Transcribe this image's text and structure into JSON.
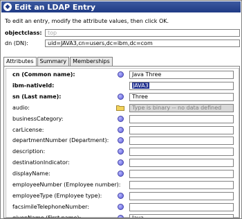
{
  "window": {
    "title": "Edit an LDAP Entry"
  },
  "instructions": "To edit an entry, modify the attribute values, then click OK.",
  "objectclass": {
    "label": "objectclass:",
    "value": "top"
  },
  "dn": {
    "label": "dn (DN):",
    "value": "uid=JAVA3,cn=users,dc=ibm,dc=com"
  },
  "tabs": [
    {
      "label": "Attributes",
      "active": true
    },
    {
      "label": "Summary",
      "active": false
    },
    {
      "label": "Memberships",
      "active": false
    }
  ],
  "attributes": [
    {
      "label": "cn (Common name):",
      "bold": true,
      "icon": "required-icon",
      "value": "Java Three",
      "style": "normal"
    },
    {
      "label": "ibm-nativeId:",
      "bold": true,
      "icon": "none",
      "value": "JAVA3",
      "style": "selected"
    },
    {
      "label": "sn (Last name):",
      "bold": true,
      "icon": "required-icon",
      "value": "Three",
      "style": "normal"
    },
    {
      "label": "audio:",
      "bold": false,
      "icon": "folder-icon",
      "value": "Type is binary -- no data defined",
      "style": "grey"
    },
    {
      "label": "businessCategory:",
      "bold": false,
      "icon": "required-icon",
      "value": "",
      "style": "normal"
    },
    {
      "label": "carLicense:",
      "bold": false,
      "icon": "required-icon",
      "value": "",
      "style": "normal"
    },
    {
      "label": "departmentNumber (Department):",
      "bold": false,
      "icon": "required-icon",
      "value": "",
      "style": "normal"
    },
    {
      "label": "description:",
      "bold": false,
      "icon": "required-icon",
      "value": "",
      "style": "normal"
    },
    {
      "label": "destinationIndicator:",
      "bold": false,
      "icon": "required-icon",
      "value": "",
      "style": "normal"
    },
    {
      "label": "displayName:",
      "bold": false,
      "icon": "required-icon",
      "value": "",
      "style": "normal"
    },
    {
      "label": "employeeNumber (Employee number):",
      "bold": false,
      "icon": "none",
      "value": "",
      "style": "normal"
    },
    {
      "label": "employeeType (Employee type):",
      "bold": false,
      "icon": "required-icon",
      "value": "",
      "style": "normal"
    },
    {
      "label": "facsimileTelephoneNumber:",
      "bold": false,
      "icon": "required-icon",
      "value": "",
      "style": "normal"
    },
    {
      "label": "givenName (First name):",
      "bold": false,
      "icon": "required-icon",
      "value": "Java",
      "style": "normal"
    }
  ]
}
